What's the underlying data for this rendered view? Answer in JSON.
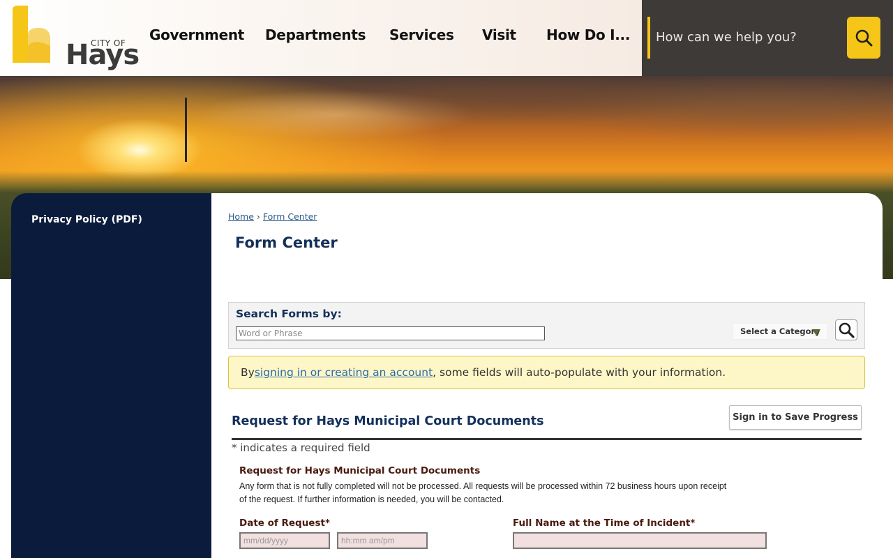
{
  "header": {
    "logo": {
      "city_of": "CITY OF",
      "name": "Hays"
    },
    "nav": [
      "Government",
      "Departments",
      "Services",
      "Visit",
      "How Do I..."
    ],
    "search_placeholder": "How can we help you?"
  },
  "colors": {
    "accent": "#f5c518",
    "navy": "#0b1b3c",
    "title": "#13305b",
    "required_field_bg": "#f2dfe0",
    "notice_bg": "#fdf7c8"
  },
  "sidebar": {
    "items": [
      {
        "label": "Privacy Policy (PDF)"
      }
    ]
  },
  "breadcrumb": {
    "home": "Home",
    "separator": "›",
    "current": "Form Center"
  },
  "page_title": "Form Center",
  "search_forms": {
    "label": "Search Forms by:",
    "placeholder": "Word or Phrase",
    "category": "Select a Category"
  },
  "notice": {
    "prefix": "By ",
    "link": "signing in or creating an account",
    "suffix": ", some fields will auto-populate with your information."
  },
  "form": {
    "title": "Request for Hays Municipal Court Documents",
    "save_button": "Sign in to Save Progress",
    "required_note": "* indicates a required field",
    "section_heading": "Request for Hays Municipal Court Documents",
    "section_desc_line1": "Any form that is not fully completed will not be processed. All requests will be processed within 72 business hours upon receipt",
    "section_desc_line2": "of the request. If further information is needed, you will be contacted.",
    "fields": {
      "date_label": "Date of Request*",
      "date_placeholder": "mm/dd/yyyy",
      "time_placeholder": "hh:mm am/pm",
      "name_label": "Full Name at the Time of Incident*",
      "name_value": ""
    }
  }
}
